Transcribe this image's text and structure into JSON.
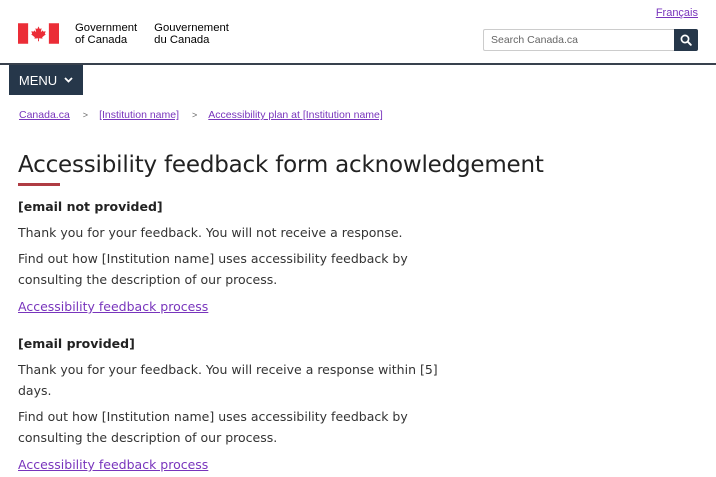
{
  "header": {
    "language_link": "Français",
    "signature_en_line1": "Government",
    "signature_en_line2": "of Canada",
    "signature_fr_line1": "Gouvernement",
    "signature_fr_line2": "du Canada",
    "search_placeholder": "Search Canada.ca",
    "menu_label": "MENU"
  },
  "breadcrumb": [
    "Canada.ca",
    "[Institution name]",
    "Accessibility plan at [Institution name]"
  ],
  "breadcrumb_separator": ">",
  "main": {
    "title": "Accessibility feedback form acknowledgement",
    "sections": [
      {
        "heading": "[email not provided]",
        "thanks": "Thank you for your feedback. You will not receive a response.",
        "info": "Find out how [Institution name] uses accessibility feedback by consulting the description of our process.",
        "link": "Accessibility feedback process"
      },
      {
        "heading": "[email provided]",
        "thanks": "Thank you for your feedback. You will receive a response within [5] days.",
        "info": "Find out how [Institution name] uses accessibility feedback by consulting the description of our process.",
        "link": "Accessibility feedback process"
      }
    ]
  },
  "colors": {
    "flag_red": "#eb2d37",
    "navy": "#26374a",
    "link": "#7834bc",
    "title_accent": "#af3c43"
  },
  "icons": {
    "flag": "canada-flag-icon",
    "search": "search-icon",
    "menu": "chevron-down-icon"
  }
}
